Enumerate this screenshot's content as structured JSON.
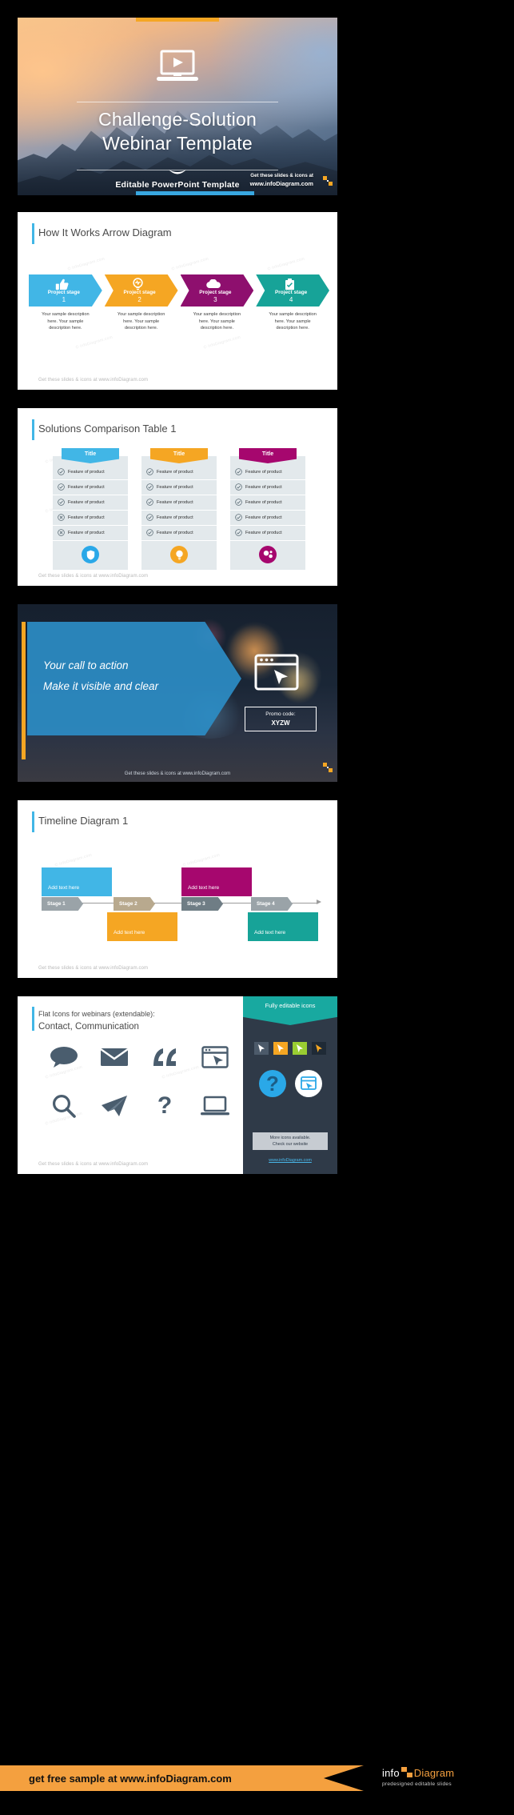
{
  "slides": [
    {
      "id": "title-slide",
      "title_line1": "Challenge-Solution",
      "title_line2": "Webinar Template",
      "subtitle": "Editable PowerPoint Template",
      "get_slides_line1": "Get these slides & icons at",
      "get_slides_line2": "www.infoDiagram.com",
      "icon": "laptop-play-icon",
      "accent_top": "#f5a623",
      "accent_bottom": "#38a7e0"
    },
    {
      "id": "arrow-diagram-slide",
      "title": "How It Works Arrow Diagram",
      "footer": "Get these slides & icons at www.infoDiagram.com",
      "footer_brand": "infoDiagram",
      "stages": [
        {
          "label": "Project stage",
          "number": "1",
          "icon": "thumbs-up-icon",
          "color": "#41b6e6",
          "description": "Your sample description here. Your sample description here."
        },
        {
          "label": "Project stage",
          "number": "2",
          "icon": "lightbulb-idea-icon",
          "color": "#f5a623",
          "description": "Your sample description here. Your sample description here."
        },
        {
          "label": "Project stage",
          "number": "3",
          "icon": "cloud-icon",
          "color": "#8e0f6e",
          "description": "Your sample description here. Your sample description here."
        },
        {
          "label": "Project stage",
          "number": "4",
          "icon": "checklist-clipboard-icon",
          "color": "#17a398",
          "description": "Your sample description here. Your sample description here."
        }
      ]
    },
    {
      "id": "comparison-table-slide",
      "title": "Solutions Comparison Table 1",
      "footer": "Get these slides & icons at www.infoDiagram.com",
      "footer_brand": "infoDiagram",
      "columns": [
        {
          "header": "Title",
          "color": "#41b6e6",
          "badge_icon": "shield-icon",
          "rows": [
            {
              "label": "Feature of product",
              "mark": "check"
            },
            {
              "label": "Feature of product",
              "mark": "check"
            },
            {
              "label": "Feature of product",
              "mark": "check"
            },
            {
              "label": "Feature of product",
              "mark": "cross"
            },
            {
              "label": "Feature of product",
              "mark": "cross"
            }
          ]
        },
        {
          "header": "Title",
          "color": "#f5a623",
          "badge_icon": "lightbulb-icon",
          "rows": [
            {
              "label": "Feature of product",
              "mark": "check"
            },
            {
              "label": "Feature of product",
              "mark": "check"
            },
            {
              "label": "Feature of product",
              "mark": "check"
            },
            {
              "label": "Feature of product",
              "mark": "check"
            },
            {
              "label": "Feature of product",
              "mark": "check"
            }
          ]
        },
        {
          "header": "Title",
          "color": "#a6076e",
          "badge_icon": "molecule-icon",
          "rows": [
            {
              "label": "Feature of product",
              "mark": "check"
            },
            {
              "label": "Feature of product",
              "mark": "check"
            },
            {
              "label": "Feature of product",
              "mark": "check"
            },
            {
              "label": "Feature of product",
              "mark": "check"
            },
            {
              "label": "Feature of product",
              "mark": "check"
            }
          ]
        }
      ]
    },
    {
      "id": "call-to-action-slide",
      "cta_line1": "Your call to action",
      "cta_line2": "Make it visible and clear",
      "promo_label": "Promo code:",
      "promo_code": "XYZW",
      "icon": "browser-cursor-icon",
      "footer": "Get these slides & icons at www.infoDiagram.com",
      "accent": "#f5a623",
      "banner_color": "#2c8cc4"
    },
    {
      "id": "timeline-slide",
      "title": "Timeline Diagram 1",
      "footer": "Get these slides & icons at www.infoDiagram.com",
      "footer_brand": "infoDiagram",
      "stages": [
        {
          "label": "Stage 1",
          "color": "#9aa3a8"
        },
        {
          "label": "Stage 2",
          "color": "#b8a98e"
        },
        {
          "label": "Stage 3",
          "color": "#6f7d85"
        },
        {
          "label": "Stage 4",
          "color": "#9aa3a8"
        }
      ],
      "cards": [
        {
          "text": "Add text here",
          "color": "#41b6e6",
          "position": "above"
        },
        {
          "text": "Add text here",
          "color": "#f5a623",
          "position": "below"
        },
        {
          "text": "Add text here",
          "color": "#a6076e",
          "position": "above"
        },
        {
          "text": "Add text here",
          "color": "#17a398",
          "position": "below"
        }
      ]
    },
    {
      "id": "icons-slide",
      "heading_line1": "Flat Icons for webinars (extendable):",
      "heading_line2": "Contact, Communication",
      "footer": "Get these slides & icons at www.infoDiagram.com",
      "footer_brand": "infoDiagram",
      "icons": [
        "speech-bubble-icon",
        "envelope-icon",
        "quote-marks-icon",
        "browser-cursor-icon",
        "magnifier-icon",
        "paper-plane-icon",
        "question-mark-icon",
        "laptop-icon"
      ],
      "panel": {
        "header": "Fully editable icons",
        "mini_icons": [
          "cursor-arrow-icon",
          "cursor-orange-icon",
          "cursor-green-icon",
          "cursor-dark-icon"
        ],
        "big_icons": [
          "question-mark-blue-icon",
          "browser-cursor-round-icon"
        ],
        "note_line1": "More icons available.",
        "note_line2": "Check our website",
        "link": "www.infoDiagram.com",
        "header_color": "#18a9a0",
        "bg_color": "#2f3a48"
      }
    }
  ],
  "banner": {
    "cta": "get free sample at www.infoDiagram.com",
    "logo_info": "info",
    "logo_diagram": "Diagram",
    "tagline": "predesigned editable slides",
    "color": "#f4a03f"
  },
  "watermark": "© infoDiagram.com"
}
